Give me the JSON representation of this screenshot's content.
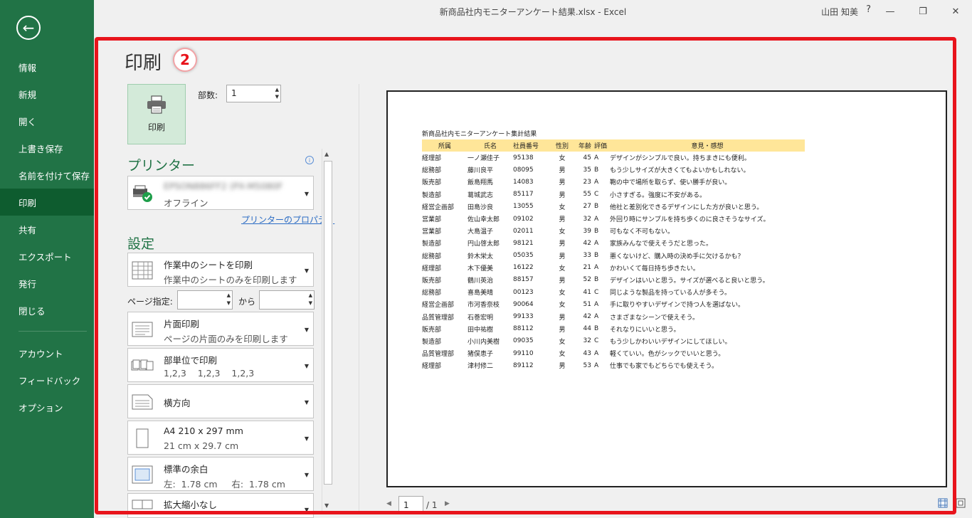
{
  "window": {
    "title": "新商品社内モニターアンケート結果.xlsx - Excel",
    "user": "山田 知美",
    "help": "?",
    "minimize": "—",
    "restore": "❐",
    "close": "✕"
  },
  "nav": {
    "back": "←",
    "items": [
      "情報",
      "新規",
      "開く",
      "上書き保存",
      "名前を付けて保存",
      "印刷",
      "共有",
      "エクスポート",
      "発行",
      "閉じる",
      "アカウント",
      "フィードバック",
      "オプション"
    ],
    "active": "印刷"
  },
  "print": {
    "title": "印刷",
    "badge": "2",
    "print_button": "印刷",
    "copies_label": "部数:",
    "copies_value": "1"
  },
  "printer": {
    "heading": "プリンター",
    "name": "EPSON886FF2 (PX-M5080F",
    "status": "オフライン",
    "properties_link": "プリンターのプロパティ"
  },
  "settings": {
    "heading": "設定",
    "what": {
      "title": "作業中のシートを印刷",
      "sub": "作業中のシートのみを印刷します"
    },
    "pages_label": "ページ指定:",
    "pages_to": "から",
    "sides": {
      "title": "片面印刷",
      "sub": "ページの片面のみを印刷します"
    },
    "collate": {
      "title": "部単位で印刷",
      "sub": "1,2,3    1,2,3    1,2,3"
    },
    "orientation": {
      "title": "横方向"
    },
    "paper": {
      "title": "A4 210 x 297 mm",
      "sub": "21 cm x 29.7 cm"
    },
    "margins": {
      "title": "標準の余白",
      "sub": "左:  1.78 cm     右:  1.78 cm"
    },
    "scaling": {
      "title": "拡大縮小なし"
    }
  },
  "preview": {
    "sheet_title": "新商品社内モニターアンケート集計結果",
    "headers": [
      "所属",
      "氏名",
      "社員番号",
      "性別",
      "年齢",
      "評価",
      "意見・感想"
    ],
    "rows": [
      [
        "経理部",
        "一ノ瀬佳子",
        "95138",
        "女",
        "45",
        "A",
        "デザインがシンプルで良い。持ちまきにも便利。"
      ],
      [
        "総務部",
        "藤川良平",
        "08095",
        "男",
        "35",
        "B",
        "もう少しサイズが大きくてもよいかもしれない。"
      ],
      [
        "販売部",
        "飯島翔馬",
        "14083",
        "男",
        "23",
        "A",
        "鞄の中で場所を取らず、使い勝手が良い。"
      ],
      [
        "製造部",
        "葛城武志",
        "85117",
        "男",
        "55",
        "C",
        "小さすぎる。強度に不安がある。"
      ],
      [
        "経営企画部",
        "田島沙良",
        "13055",
        "女",
        "27",
        "B",
        "他社と差別化できるデザインにした方が良いと思う。"
      ],
      [
        "営業部",
        "佐山幸太郎",
        "09102",
        "男",
        "32",
        "A",
        "外回り時にサンプルを持ち歩くのに良さそうなサイズ。"
      ],
      [
        "営業部",
        "大島温子",
        "02011",
        "女",
        "39",
        "B",
        "可もなく不可もない。"
      ],
      [
        "製造部",
        "円山啓太郎",
        "98121",
        "男",
        "42",
        "A",
        "家族みんなで使えそうだと思った。"
      ],
      [
        "総務部",
        "鈴木栄太",
        "05035",
        "男",
        "33",
        "B",
        "悪くないけど、購入時の決め手に欠けるかも？"
      ],
      [
        "経理部",
        "木下優美",
        "16122",
        "女",
        "21",
        "A",
        "かわいくて毎日持ち歩きたい。"
      ],
      [
        "販売部",
        "鶴川英治",
        "88157",
        "男",
        "52",
        "B",
        "デザインはいいと思う。サイズが選べると良いと思う。"
      ],
      [
        "総務部",
        "喜島美晴",
        "00123",
        "女",
        "41",
        "C",
        "同じような製品を持っている人が多そう。"
      ],
      [
        "経営企画部",
        "市河香奈枝",
        "90064",
        "女",
        "51",
        "A",
        "手に取りやすいデザインで持つ人を選ばない。"
      ],
      [
        "品質管理部",
        "石巻宏明",
        "99133",
        "男",
        "42",
        "A",
        "さまざまなシーンで使えそう。"
      ],
      [
        "販売部",
        "田中祐樹",
        "88112",
        "男",
        "44",
        "B",
        "それなりにいいと思う。"
      ],
      [
        "製造部",
        "小川内美樹",
        "09035",
        "女",
        "32",
        "C",
        "もう少しかわいいデザインにしてほしい。"
      ],
      [
        "品質管理部",
        "猪俣恵子",
        "99110",
        "女",
        "43",
        "A",
        "軽くていい。色がシックでいいと思う。"
      ],
      [
        "経理部",
        "津村修二",
        "89112",
        "男",
        "53",
        "A",
        "仕事でも家でもどちらでも使えそう。"
      ]
    ]
  },
  "pager": {
    "current": "1",
    "total": "/ 1",
    "prev": "◀",
    "next": "▶"
  },
  "colors": {
    "nav_green": "#217346",
    "nav_active": "#0e5c2f",
    "highlight_red": "#e8141c",
    "table_header": "#ffe699"
  }
}
